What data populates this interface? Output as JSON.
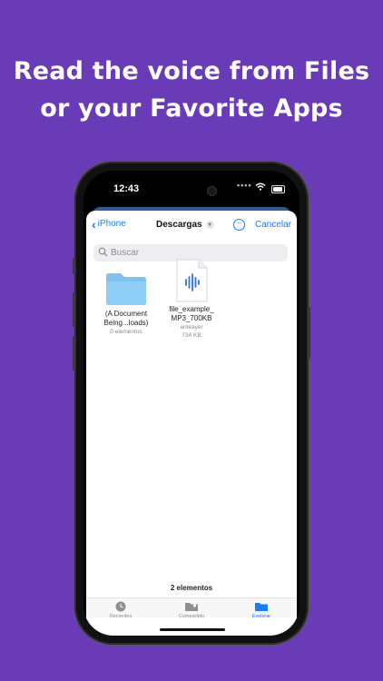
{
  "headline": {
    "line1": "Read the voice from Files",
    "line2": "or your Favorite Apps"
  },
  "status_bar": {
    "time": "12:43"
  },
  "navbar": {
    "back_label": "iPhone",
    "title": "Descargas",
    "cancel_label": "Cancelar"
  },
  "search": {
    "placeholder": "Buscar"
  },
  "items": [
    {
      "type": "folder",
      "name_line1": "(A Document",
      "name_line2": "Being...loads)",
      "meta1": "0 elementos",
      "meta2": ""
    },
    {
      "type": "audio-file",
      "name_line1": "file_example_",
      "name_line2": "MP3_700KB",
      "meta1": "anteayer",
      "meta2": "734 KB"
    }
  ],
  "footer": {
    "count": "2 elementos"
  },
  "tabs": [
    {
      "label": "Recientes",
      "icon": "clock-icon",
      "active": false
    },
    {
      "label": "Compartido",
      "icon": "shared-folder-icon",
      "active": false
    },
    {
      "label": "Explorar",
      "icon": "folder-icon",
      "active": true
    }
  ],
  "colors": {
    "background": "#6a3bb6",
    "accent": "#1a7cf2",
    "folder": "#7cc2f2"
  }
}
